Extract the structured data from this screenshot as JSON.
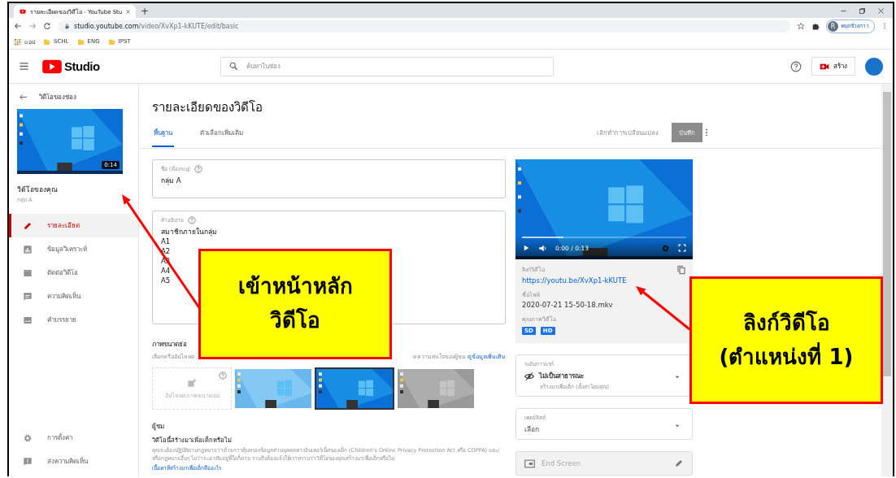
{
  "browser": {
    "tabs": [
      {
        "title": "รายละเอียดของวิดีโอ - YouTube Stu",
        "selected": true
      }
    ],
    "new_tab": "+",
    "url_host": "studio.youtube.com",
    "url_path": "/video/XvXp1-kKUTE/edit/basic",
    "bookmarks": [
      {
        "kind": "apps",
        "label": "แอป"
      },
      {
        "kind": "folder",
        "label": "SCHL"
      },
      {
        "kind": "folder",
        "label": "ENG"
      },
      {
        "kind": "folder",
        "label": "IPST"
      }
    ],
    "profile": {
      "initial": "R",
      "label": "หยุดชั่วคราว"
    }
  },
  "header": {
    "logo": "Studio",
    "search_placeholder": "ค้นหาในช่อง",
    "create_label": "สร้าง"
  },
  "sidebar": {
    "back_label": "วิดีโอของช่อง",
    "duration": "0:14",
    "video_heading": "วิดีโอของคุณ",
    "video_title": "กลุ่ม A",
    "items": [
      {
        "kind": "pencil",
        "label": "รายละเอียด",
        "selected": true
      },
      {
        "kind": "chart",
        "label": "ข้อมูลวิเคราะห์",
        "selected": false
      },
      {
        "kind": "clapper",
        "label": "ตัดต่อวิดีโอ",
        "selected": false
      },
      {
        "kind": "comment",
        "label": "ความคิดเห็น",
        "selected": false
      },
      {
        "kind": "subtitles",
        "label": "คำบรรยาย",
        "selected": false
      }
    ],
    "bottom_items": [
      {
        "kind": "gear",
        "label": "การตั้งค่า",
        "selected": false
      },
      {
        "kind": "feedback",
        "label": "ส่งความคิดเห็น",
        "selected": false
      }
    ]
  },
  "main": {
    "title": "รายละเอียดของวิดีโอ",
    "tabs": [
      {
        "label": "พื้นฐาน",
        "selected": true
      },
      {
        "label": "ตัวเลือกเพิ่มเติม",
        "selected": false
      }
    ],
    "undo_label": "เลิกทำการเปลี่ยนแปลง",
    "save_label": "บันทึก",
    "save_disabled": true,
    "title_field": {
      "label": "ชื่อ (ต้องระบุ)",
      "value": "กลุ่ม A"
    },
    "description_field": {
      "label": "คำอธิบาย",
      "lines": [
        "สมาชิกภายในกลุ่ม",
        "A1",
        "A2",
        "A3",
        "A4",
        "A5"
      ]
    },
    "thumbnails": {
      "heading": "ภาพขนาดย่อ",
      "description_start": "เลือกหรืออัปโหลด",
      "description_end": "ดความสนใจของผู้ชม",
      "link": "ดูข้อมูลเพิ่มเติม",
      "items": [
        {
          "kind": "upload",
          "label": "อัปโหลดภาพขนาดย่อ",
          "selected": false
        },
        {
          "kind": "picture",
          "selected": false
        },
        {
          "kind": "picture",
          "selected": true
        },
        {
          "kind": "picture",
          "selected": false
        }
      ]
    },
    "audience": {
      "heading": "ผู้ชม",
      "question": "วิดีโอนี้สร้างมาเพื่อเด็กหรือไม่",
      "text": "คุณจะต้องปฏิบัติตามกฎหมายว่าด้วยการคุ้มครองข้อมูลส่วนบุคคลทางอินเทอร์เน็ตของเด็ก (Children's Online Privacy Protection Act หรือ COPPA) และ/หรือกฎหมายอื่นๆ ไม่ว่าจะอาศัยอยู่ที่ใดก็ตาม รวมถึงต้องแจ้งให้เราทราบว่าวิดีโอของคุณสร้างมาเพื่อเด็กหรือไม่",
      "link": "เนื้อหาที่สร้างมาเพื่อเด็กคืออะไร"
    },
    "player": {
      "time": "0:00 / 0:13",
      "seek_bar": {
        "level": 0.25
      }
    },
    "info": {
      "link_label": "ลิงก์วิดีโอ",
      "link": "https://youtu.be/XvXp1-kKUTE",
      "file_label": "ชื่อไฟล์",
      "file": "2020-07-21 15-50-18.mkv",
      "quality_label": "คุณภาพวิดีโอ",
      "qualities": [
        "SD",
        "HD"
      ]
    },
    "visibility": {
      "label": "ระดับการแชร์",
      "value": "ไม่เป็นสาธารณะ",
      "note": "สร้างมาเพื่อเด็ก (ตั้งค่าโดยคุณ)"
    },
    "playlist": {
      "label": "เพลย์ลิสต์",
      "value": "เลือก"
    },
    "end_screen": {
      "label": "End Screen"
    }
  },
  "callouts": [
    {
      "lines": [
        "เข้าหน้าหลัก",
        "วิดีโอ"
      ]
    },
    {
      "lines": [
        "ลิงก์วิดีโอ",
        "(ตำแหน่งที่ 1)"
      ]
    }
  ]
}
